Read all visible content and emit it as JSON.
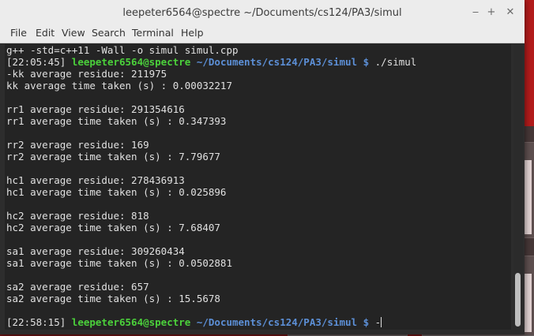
{
  "window": {
    "title": "leepeter6564@spectre ~/Documents/cs124/PA3/simul",
    "buttons": {
      "minimize": "‒",
      "maximize": "+",
      "close": "✕"
    }
  },
  "menu": [
    "File",
    "Edit",
    "View",
    "Search",
    "Terminal",
    "Help"
  ],
  "terminal": {
    "compile_cmd": "g++ -std=c++11 -Wall -o simul simul.cpp",
    "prompt1": {
      "time": "[22:05:45]",
      "user": "leepeter6564@spectre",
      "path": "~/Documents/cs124/PA3/simul",
      "dollar": "$",
      "cmd": "./simul"
    },
    "output": [
      "-kk average residue: 211975",
      "kk average time taken (s) : 0.00032217",
      "",
      "rr1 average residue: 291354616",
      "rr1 average time taken (s) : 0.347393",
      "",
      "rr2 average residue: 169",
      "rr2 average time taken (s) : 7.79677",
      "",
      "hc1 average residue: 278436913",
      "hc1 average time taken (s) : 0.025896",
      "",
      "hc2 average residue: 818",
      "hc2 average time taken (s) : 7.68407",
      "",
      "sa1 average residue: 309260434",
      "sa1 average time taken (s) : 0.0502881",
      "",
      "sa2 average residue: 657",
      "sa2 average time taken (s) : 15.5678",
      ""
    ],
    "prompt2": {
      "time": "[22:58:15]",
      "user": "leepeter6564@spectre",
      "path": "~/Documents/cs124/PA3/simul",
      "dollar": "$",
      "cmd": "-"
    }
  },
  "colors": {
    "user": "#4bd13b",
    "path": "#5c8fd6",
    "terminal_bg": "#242424",
    "text": "#e0e0e0"
  }
}
